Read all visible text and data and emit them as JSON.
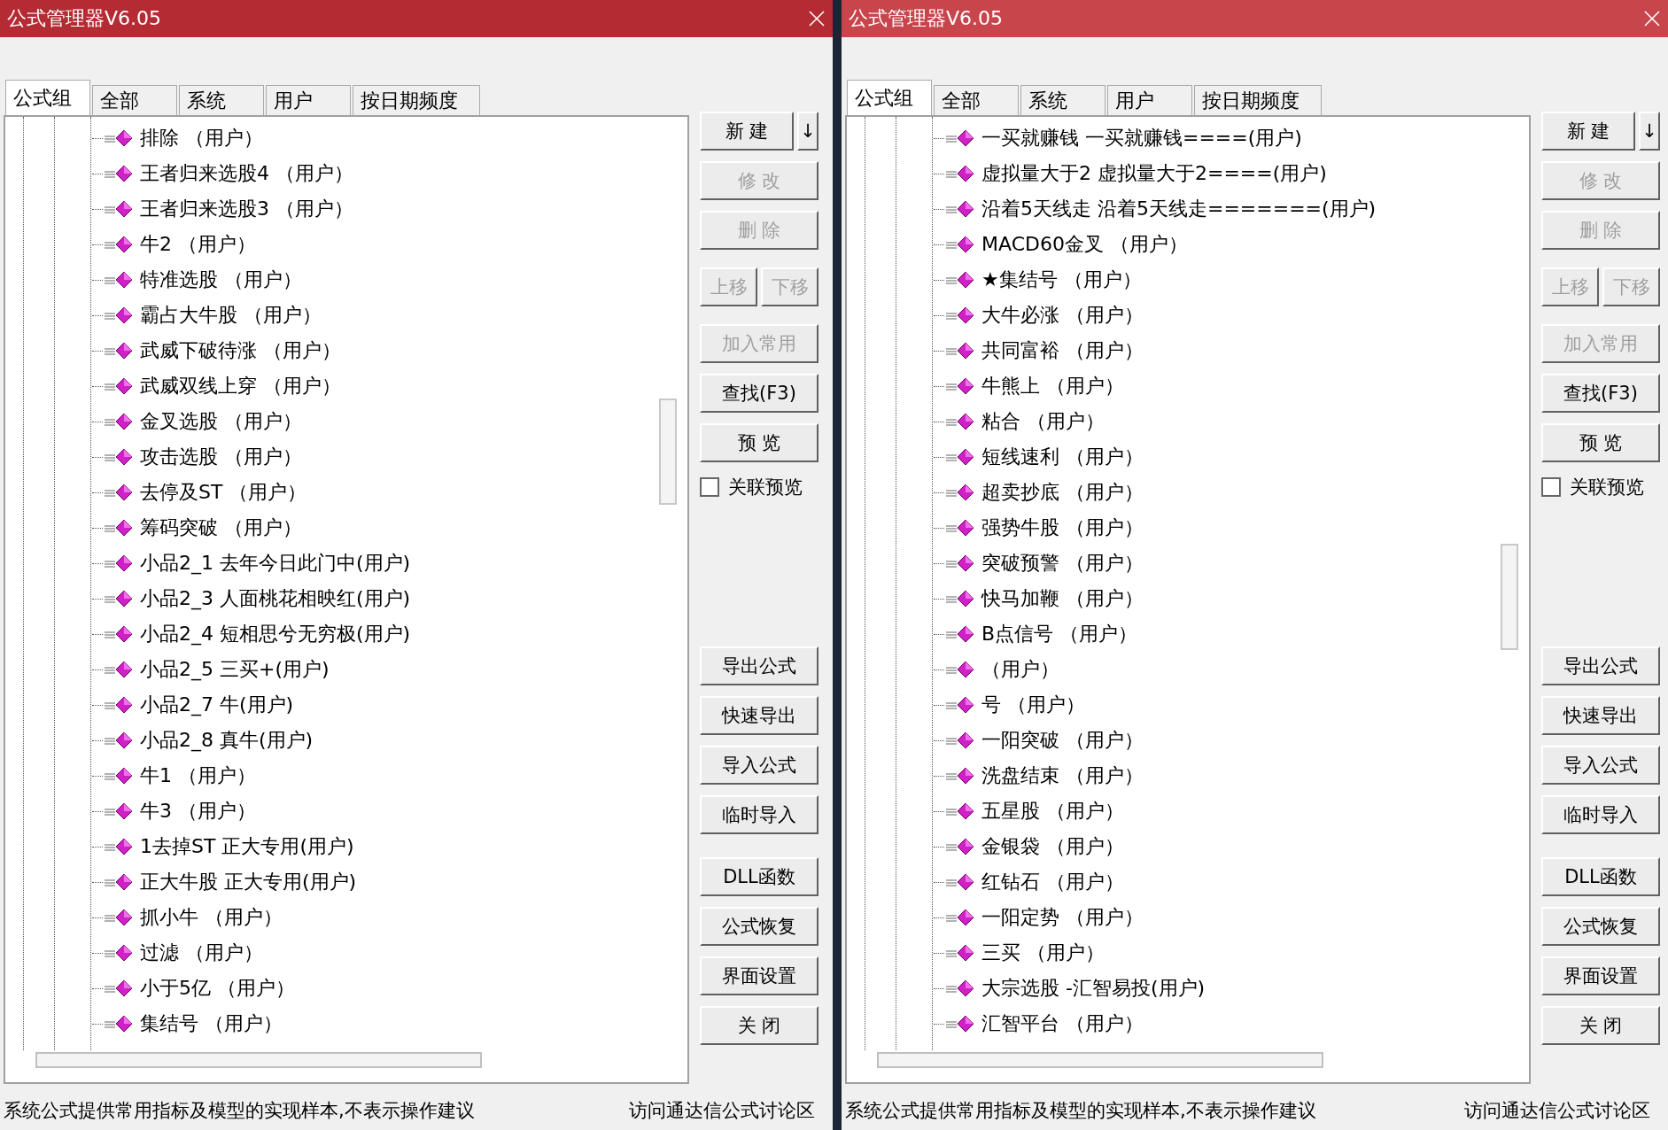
{
  "windows": [
    {
      "title": "公式管理器V6.05",
      "active": true,
      "tabs": [
        {
          "label": "公式组",
          "selected": true
        },
        {
          "label": "全部",
          "selected": false
        },
        {
          "label": "系统",
          "selected": false
        },
        {
          "label": "用户",
          "selected": false
        },
        {
          "label": "按日期频度",
          "selected": false
        }
      ],
      "items": [
        {
          "label": "排除 （用户）"
        },
        {
          "label": "王者归来选股4 （用户）"
        },
        {
          "label": "王者归来选股3 （用户）"
        },
        {
          "label": "牛2 （用户）"
        },
        {
          "label": "特准选股 （用户）"
        },
        {
          "label": "霸占大牛股 （用户）"
        },
        {
          "label": "武威下破待涨 （用户）"
        },
        {
          "label": "武威双线上穿 （用户）"
        },
        {
          "label": "金叉选股 （用户）"
        },
        {
          "label": "攻击选股 （用户）"
        },
        {
          "label": "去停及ST （用户）"
        },
        {
          "label": "筹码突破 （用户）"
        },
        {
          "label": "小品2_1  去年今日此门中(用户)"
        },
        {
          "label": "小品2_3  人面桃花相映红(用户)"
        },
        {
          "label": "小品2_4  短相思兮无穷极(用户)"
        },
        {
          "label": "小品2_5  三买+(用户)"
        },
        {
          "label": "小品2_7  牛(用户)"
        },
        {
          "label": "小品2_8  真牛(用户)"
        },
        {
          "label": "牛1 （用户）"
        },
        {
          "label": "牛3 （用户）"
        },
        {
          "label": "1去掉ST  正大专用(用户)"
        },
        {
          "label": "正大牛股  正大专用(用户)"
        },
        {
          "label": "抓小牛 （用户）"
        },
        {
          "label": "过滤 （用户）"
        },
        {
          "label": "小于5亿 （用户）"
        },
        {
          "label": "集结号 （用户）"
        }
      ],
      "top_buttons": [
        [
          {
            "label": "新 建",
            "kind": "main",
            "disabled": false
          },
          {
            "label": "↓",
            "kind": "narrow",
            "disabled": false
          }
        ],
        [
          {
            "label": "修 改",
            "kind": "main",
            "disabled": true
          }
        ],
        [
          {
            "label": "删 除",
            "kind": "main",
            "disabled": true
          }
        ],
        [
          {
            "label": "上移",
            "kind": "half",
            "disabled": true
          },
          {
            "label": "下移",
            "kind": "half",
            "disabled": true
          }
        ],
        [
          {
            "label": "加入常用",
            "kind": "main",
            "disabled": true
          }
        ],
        [
          {
            "label": "查找(F3)",
            "kind": "main",
            "disabled": false
          }
        ],
        [
          {
            "label": "预 览",
            "kind": "main",
            "disabled": false
          }
        ]
      ],
      "checkbox": {
        "label": "关联预览",
        "checked": false
      },
      "mid_buttons": [
        {
          "label": "导出公式"
        },
        {
          "label": "快速导出"
        },
        {
          "label": "导入公式"
        },
        {
          "label": "临时导入"
        }
      ],
      "bottom_buttons": [
        {
          "label": "DLL函数"
        },
        {
          "label": "公式恢复"
        },
        {
          "label": "界面设置"
        },
        {
          "label": "关 闭"
        }
      ],
      "status": "系统公式提供常用指标及模型的实现样本,不表示操作建议",
      "link": "访问通达信公式讨论区"
    },
    {
      "title": "公式管理器V6.05",
      "active": false,
      "tabs": [
        {
          "label": "公式组",
          "selected": true
        },
        {
          "label": "全部",
          "selected": false
        },
        {
          "label": "系统",
          "selected": false
        },
        {
          "label": "用户",
          "selected": false
        },
        {
          "label": "按日期频度",
          "selected": false
        }
      ],
      "items": [
        {
          "label": "一买就赚钱  一买就赚钱====(用户)"
        },
        {
          "label": "虚拟量大于2  虚拟量大于2====(用户)"
        },
        {
          "label": "沿着5天线走  沿着5天线走=======(用户)"
        },
        {
          "label": "MACD60金叉 （用户）"
        },
        {
          "label": "★集结号 （用户）"
        },
        {
          "label": "大牛必涨 （用户）"
        },
        {
          "label": "共同富裕 （用户）"
        },
        {
          "label": "牛熊上 （用户）"
        },
        {
          "label": "粘合 （用户）"
        },
        {
          "label": "短线速利 （用户）"
        },
        {
          "label": "超卖抄底 （用户）"
        },
        {
          "label": "强势牛股 （用户）"
        },
        {
          "label": "突破预警 （用户）"
        },
        {
          "label": "快马加鞭 （用户）"
        },
        {
          "label": "B点信号 （用户）"
        },
        {
          "label": "（用户）"
        },
        {
          "label": "号 （用户）"
        },
        {
          "label": "一阳突破 （用户）"
        },
        {
          "label": "洗盘结束 （用户）"
        },
        {
          "label": "五星股 （用户）"
        },
        {
          "label": "金银袋 （用户）"
        },
        {
          "label": "红钻石 （用户）"
        },
        {
          "label": "一阳定势 （用户）"
        },
        {
          "label": "三买 （用户）"
        },
        {
          "label": "大宗选股  -汇智易投(用户)"
        },
        {
          "label": "汇智平台 （用户）"
        }
      ],
      "top_buttons": [
        [
          {
            "label": "新 建",
            "kind": "main",
            "disabled": false
          },
          {
            "label": "↓",
            "kind": "narrow",
            "disabled": false
          }
        ],
        [
          {
            "label": "修 改",
            "kind": "main",
            "disabled": true
          }
        ],
        [
          {
            "label": "删 除",
            "kind": "main",
            "disabled": true
          }
        ],
        [
          {
            "label": "上移",
            "kind": "half",
            "disabled": true
          },
          {
            "label": "下移",
            "kind": "half",
            "disabled": true
          }
        ],
        [
          {
            "label": "加入常用",
            "kind": "main",
            "disabled": true
          }
        ],
        [
          {
            "label": "查找(F3)",
            "kind": "main",
            "disabled": false
          }
        ],
        [
          {
            "label": "预 览",
            "kind": "main",
            "disabled": false
          }
        ]
      ],
      "checkbox": {
        "label": "关联预览",
        "checked": false
      },
      "mid_buttons": [
        {
          "label": "导出公式"
        },
        {
          "label": "快速导出"
        },
        {
          "label": "导入公式"
        },
        {
          "label": "临时导入"
        }
      ],
      "bottom_buttons": [
        {
          "label": "DLL函数"
        },
        {
          "label": "公式恢复"
        },
        {
          "label": "界面设置"
        },
        {
          "label": "关 闭"
        }
      ],
      "status": "系统公式提供常用指标及模型的实现样本,不表示操作建议",
      "link": "访问通达信公式讨论区"
    }
  ]
}
